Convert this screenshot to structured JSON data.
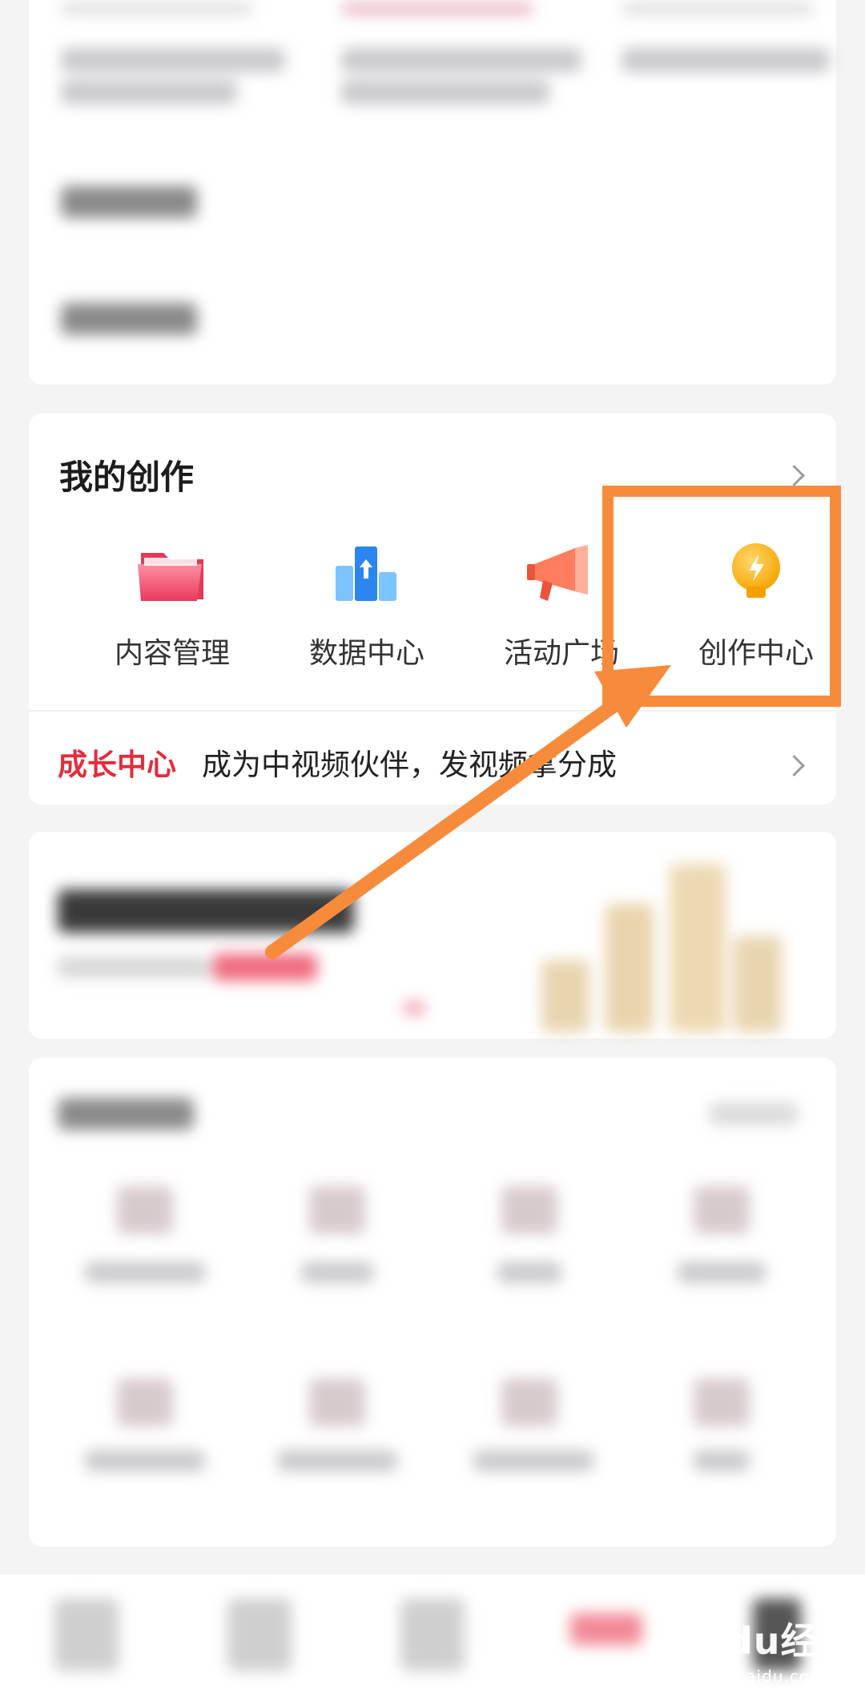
{
  "creation": {
    "title": "我的创作",
    "tools": [
      {
        "label": "内容管理",
        "icon": "folder-icon"
      },
      {
        "label": "数据中心",
        "icon": "data-chart-icon"
      },
      {
        "label": "活动广场",
        "icon": "megaphone-icon"
      },
      {
        "label": "创作中心",
        "icon": "lightbulb-icon"
      }
    ]
  },
  "growth": {
    "tag": "成长中心",
    "text": "成为中视频伙伴，发视频拿分成"
  },
  "watermark": {
    "brand": "Baidu经验",
    "url": "jingyan.baidu.com"
  },
  "colors": {
    "highlight": "#f78b3c",
    "accent": "#e62b3b"
  }
}
